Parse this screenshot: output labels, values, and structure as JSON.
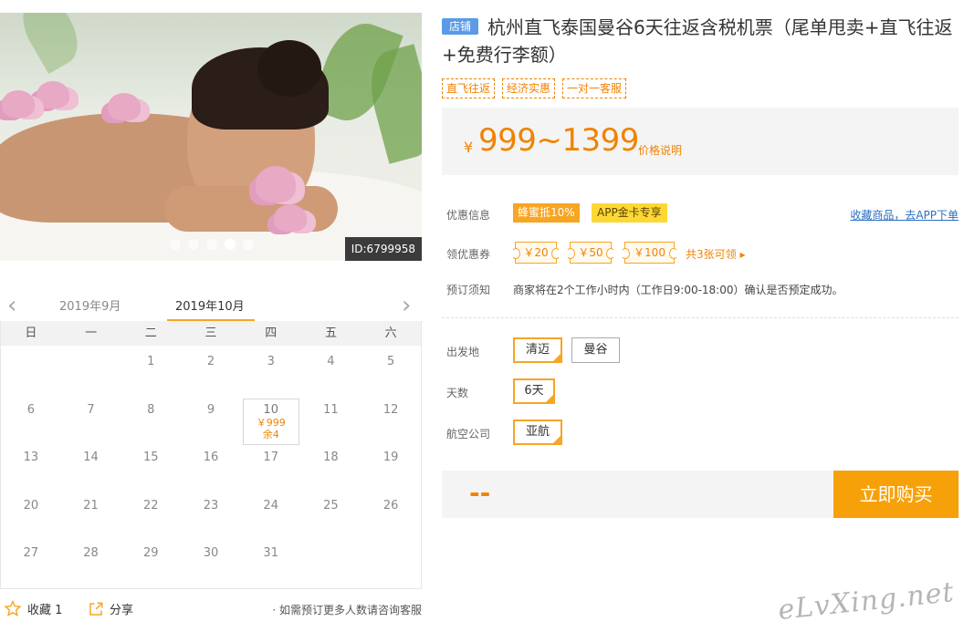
{
  "gallery": {
    "id_tag": "ID:6799958",
    "active_index": 4,
    "total": 5
  },
  "calendar": {
    "prev_month": "2019年9月",
    "current_month": "2019年10月",
    "weekdays": [
      "日",
      "一",
      "二",
      "三",
      "四",
      "五",
      "六"
    ],
    "days": [
      {
        "d": ""
      },
      {
        "d": ""
      },
      {
        "d": "1"
      },
      {
        "d": "2"
      },
      {
        "d": "3"
      },
      {
        "d": "4"
      },
      {
        "d": "5"
      },
      {
        "d": "6"
      },
      {
        "d": "7"
      },
      {
        "d": "8"
      },
      {
        "d": "9"
      },
      {
        "d": "10",
        "price": "￥999",
        "remain": "余4",
        "selected": true
      },
      {
        "d": "11"
      },
      {
        "d": "12"
      },
      {
        "d": "13"
      },
      {
        "d": "14"
      },
      {
        "d": "15"
      },
      {
        "d": "16"
      },
      {
        "d": "17"
      },
      {
        "d": "18"
      },
      {
        "d": "19"
      },
      {
        "d": "20"
      },
      {
        "d": "21"
      },
      {
        "d": "22"
      },
      {
        "d": "23"
      },
      {
        "d": "24"
      },
      {
        "d": "25"
      },
      {
        "d": "26"
      },
      {
        "d": "27"
      },
      {
        "d": "28"
      },
      {
        "d": "29"
      },
      {
        "d": "30"
      },
      {
        "d": "31"
      },
      {
        "d": ""
      },
      {
        "d": ""
      }
    ]
  },
  "footer": {
    "favorite_label": "收藏 1",
    "share_label": "分享",
    "consult_text": "· 如需预订更多人数请咨询客服"
  },
  "product": {
    "shop_tag": "店铺",
    "title": "杭州直飞泰国曼谷6天往返含税机票（尾单甩卖+直飞往返+免费行李额）",
    "tags": [
      "直飞往返",
      "经济实惠",
      "一对一客服"
    ],
    "price_currency": "¥",
    "price_range": "999~1399",
    "price_explain": "价格说明"
  },
  "promo": {
    "label": "优惠信息",
    "badge1": "蜂蜜抵10%",
    "badge2": "APP金卡专享",
    "collect_link": "收藏商品，去APP下单"
  },
  "coupons": {
    "label": "领优惠券",
    "items": [
      "￥20",
      "￥50",
      "￥100"
    ],
    "count_text": "共3张可领 ▸"
  },
  "notice": {
    "label": "预订须知",
    "text": "商家将在2个工作小时内（工作日9:00-18:00）确认是否预定成功。"
  },
  "options": {
    "departure_label": "出发地",
    "departure": [
      "清迈",
      "曼谷"
    ],
    "days_label": "天数",
    "days": [
      "6天"
    ],
    "airline_label": "航空公司",
    "airline": [
      "亚航"
    ]
  },
  "purchase": {
    "total": "--",
    "buy_label": "立即购买"
  },
  "watermark": "eLvXing.net",
  "colors": {
    "accent": "#f08300",
    "button": "#f7a10a",
    "shop_tag": "#5b9ae6",
    "link": "#2a6fc0"
  }
}
